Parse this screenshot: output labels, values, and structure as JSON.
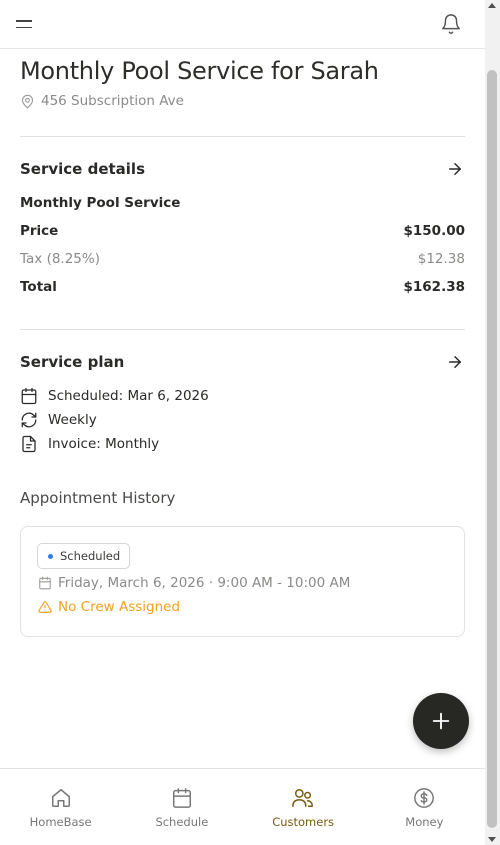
{
  "header": {
    "menu_icon": "hamburger-menu-icon",
    "bell_icon": "bell-icon"
  },
  "page": {
    "title": "Monthly Pool Service for Sarah",
    "address": "456 Subscription Ave"
  },
  "service_details": {
    "title": "Service details",
    "service_name": "Monthly Pool Service",
    "price_label": "Price",
    "price_value": "$150.00",
    "tax_label": "Tax (8.25%)",
    "tax_value": "$12.38",
    "total_label": "Total",
    "total_value": "$162.38"
  },
  "service_plan": {
    "title": "Service plan",
    "scheduled": "Scheduled: Mar 6, 2026",
    "frequency": "Weekly",
    "invoice": "Invoice: Monthly"
  },
  "appointment_history": {
    "title": "Appointment History",
    "appointments": [
      {
        "status": "Scheduled",
        "status_color": "#2f7ae5",
        "datetime": "Friday, March 6, 2026 · 9:00 AM - 10:00 AM",
        "warning": "No Crew Assigned",
        "warning_color": "#f0a020"
      }
    ]
  },
  "fab": {
    "icon": "plus-icon"
  },
  "nav": {
    "items": [
      {
        "label": "HomeBase",
        "icon": "home-icon"
      },
      {
        "label": "Schedule",
        "icon": "calendar-icon"
      },
      {
        "label": "Customers",
        "icon": "users-icon",
        "active": true
      },
      {
        "label": "Money",
        "icon": "dollar-circle-icon"
      }
    ]
  },
  "colors": {
    "accent": "#7a5a10",
    "fab": "#272723",
    "status_blue": "#2f7ae5",
    "warning": "#f0a020"
  }
}
